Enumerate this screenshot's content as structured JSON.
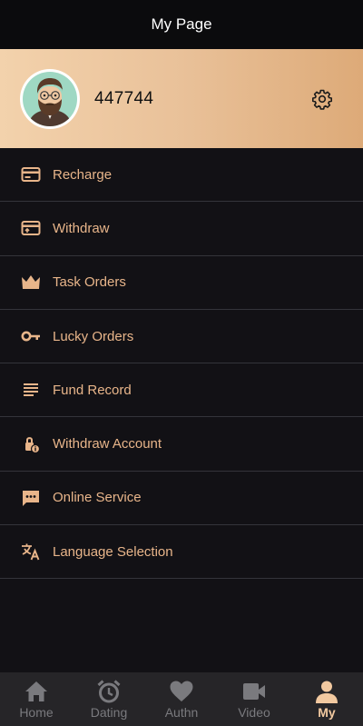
{
  "header": {
    "title": "My Page"
  },
  "profile": {
    "user_id": "447744"
  },
  "menu": [
    {
      "label": "Recharge",
      "icon": "card-icon"
    },
    {
      "label": "Withdraw",
      "icon": "card-withdraw-icon"
    },
    {
      "label": "Task Orders",
      "icon": "crown-icon"
    },
    {
      "label": "Lucky Orders",
      "icon": "key-icon"
    },
    {
      "label": "Fund Record",
      "icon": "list-icon"
    },
    {
      "label": "Withdraw Account",
      "icon": "lock-info-icon"
    },
    {
      "label": "Online Service",
      "icon": "chat-icon"
    },
    {
      "label": "Language Selection",
      "icon": "translate-icon"
    }
  ],
  "tabs": [
    {
      "label": "Home",
      "icon": "home-icon"
    },
    {
      "label": "Dating",
      "icon": "alarm-clock-icon"
    },
    {
      "label": "Authn",
      "icon": "heart-icon"
    },
    {
      "label": "Video",
      "icon": "video-camera-icon"
    },
    {
      "label": "My",
      "icon": "person-icon",
      "active": true
    }
  ],
  "colors": {
    "accent": "#e8b58a",
    "active_tab": "#f2c9a0",
    "inactive_tab": "#7a7a7e",
    "background": "#121115"
  }
}
